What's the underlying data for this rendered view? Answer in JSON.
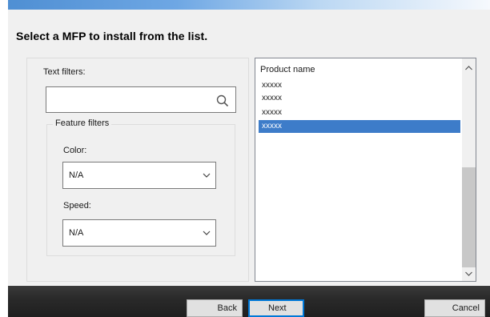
{
  "dialog": {
    "title": "Select a MFP to install from the list."
  },
  "filters": {
    "text_filters_label": "Text filters:",
    "text_filter_value": "",
    "feature_filters_label": "Feature filters",
    "color": {
      "label": "Color:",
      "selected": "N/A"
    },
    "speed": {
      "label": "Speed:",
      "selected": "N/A"
    }
  },
  "product_list": {
    "header": "Product name",
    "items": [
      {
        "name": "xxxxx",
        "selected": false
      },
      {
        "name": "xxxxx",
        "selected": false
      },
      {
        "name": "xxxxx",
        "selected": false
      },
      {
        "name": "xxxxx",
        "selected": true
      }
    ]
  },
  "buttons": {
    "back": "Back",
    "next": "Next",
    "cancel": "Cancel"
  },
  "icons": {
    "search": "search-icon",
    "dropdown": "chevron-down-icon",
    "scroll_up": "chevron-up-icon",
    "scroll_down": "chevron-down-icon"
  },
  "colors": {
    "selection": "#3d7cc9",
    "dialog_background": "#f0f0f0",
    "footer": "#2a2a2a",
    "default_button_border": "#0078d7"
  }
}
